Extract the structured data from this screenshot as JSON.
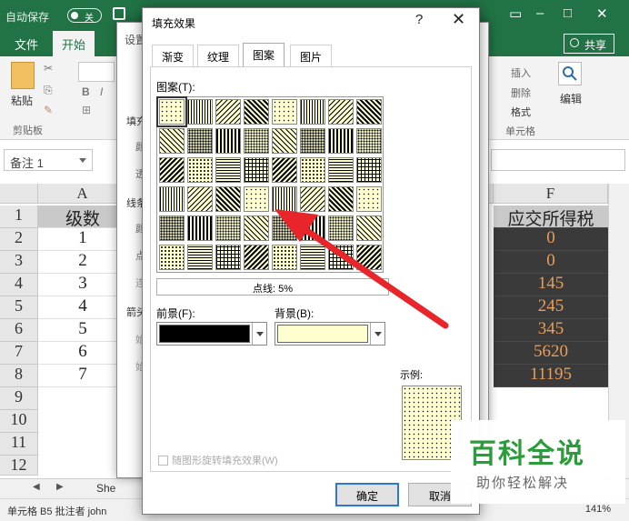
{
  "titlebar": {
    "autosave": "自动保存",
    "toggle_state": "关"
  },
  "ribbon_tabs": [
    {
      "label": "文件"
    },
    {
      "label": "开始"
    }
  ],
  "share_button": "共享",
  "ribbon": {
    "paste": "粘贴",
    "clipboard": "剪贴板",
    "insert": "插入",
    "delete": "删除",
    "format": "格式",
    "cells": "单元格",
    "edit": "编辑"
  },
  "namebox": "备注 1",
  "sheet": {
    "col_a": "A",
    "col_f": "F",
    "rows": [
      "1",
      "2",
      "3",
      "4",
      "5",
      "6",
      "7",
      "8",
      "9",
      "10",
      "11",
      "12"
    ],
    "col_a_values": [
      "级数",
      "1",
      "2",
      "3",
      "4",
      "5",
      "6",
      "7"
    ],
    "col_f_values": [
      "应交所得税",
      "0",
      "0",
      "145",
      "245",
      "345",
      "5620",
      "11195"
    ]
  },
  "sheet_tab": "She",
  "statusbar": {
    "text": "单元格 B5 批注者 john",
    "zoom": "141%"
  },
  "back_dialog": {
    "title": "设置",
    "labels": [
      "填充",
      "颜",
      "透",
      "线条",
      "颜",
      "点",
      "连",
      "箭头",
      "始",
      "始"
    ]
  },
  "fill_effects": {
    "title": "填充效果",
    "help": "?",
    "tabs": [
      "渐变",
      "纹理",
      "图案",
      "图片"
    ],
    "selected_tab": 2,
    "pattern_label": "图案(T):",
    "pattern_name": "点线: 5%",
    "foreground_label": "前景(F):",
    "background_label": "背景(B):",
    "foreground_color": "#000000",
    "background_color": "#ffffd0",
    "sample_label": "示例:",
    "rotate_label": "随图形旋转填充效果(W)",
    "ok": "确定",
    "cancel": "取消"
  },
  "watermark": {
    "title": "百科全说",
    "subtitle": "助你轻松解决"
  },
  "colors": {
    "excel_green": "#217346",
    "dialog_accent": "#2b78d4",
    "arrow_red": "#e8252b"
  }
}
